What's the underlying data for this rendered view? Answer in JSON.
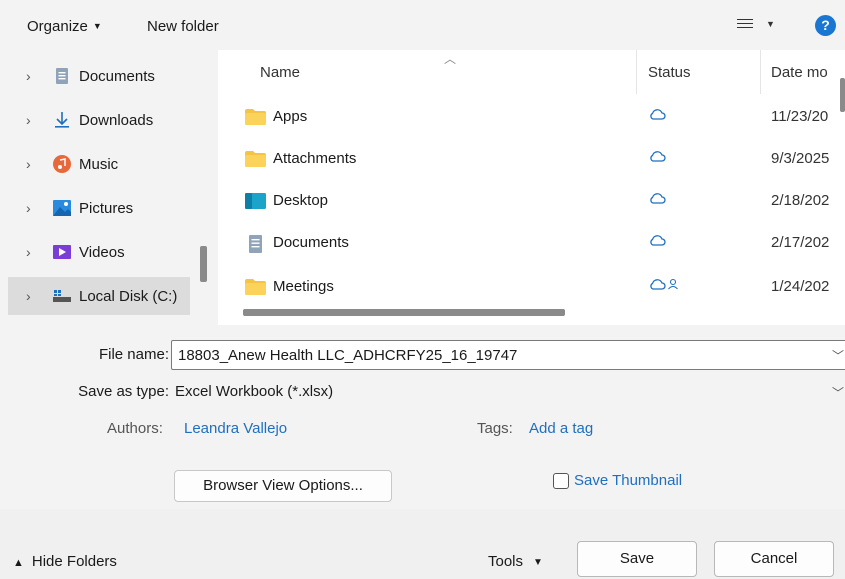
{
  "toolbar": {
    "organize_label": "Organize",
    "new_folder_label": "New folder",
    "help_label": "?"
  },
  "nav": {
    "items": [
      {
        "label": "Documents",
        "icon": "document-icon"
      },
      {
        "label": "Downloads",
        "icon": "download-arrow-icon"
      },
      {
        "label": "Music",
        "icon": "music-icon"
      },
      {
        "label": "Pictures",
        "icon": "pictures-icon"
      },
      {
        "label": "Videos",
        "icon": "videos-icon"
      },
      {
        "label": "Local Disk (C:)",
        "icon": "drive-icon",
        "selected": true
      }
    ]
  },
  "list": {
    "columns": {
      "name": "Name",
      "status": "Status",
      "date": "Date mo"
    },
    "rows": [
      {
        "name": "Apps",
        "type": "folder",
        "status": "cloud",
        "date": "11/23/20"
      },
      {
        "name": "Attachments",
        "type": "folder",
        "status": "cloud",
        "date": "9/3/2025"
      },
      {
        "name": "Desktop",
        "type": "desktop",
        "status": "cloud",
        "date": "2/18/202"
      },
      {
        "name": "Documents",
        "type": "document",
        "status": "cloud",
        "date": "2/17/202"
      },
      {
        "name": "Meetings",
        "type": "folder",
        "status": "cloud-shared",
        "date": "1/24/202"
      }
    ]
  },
  "form": {
    "file_name_label": "File name:",
    "file_name_value": "18803_Anew Health LLC_ADHCRFY25_16_19747",
    "save_type_label": "Save as type:",
    "save_type_value": "Excel Workbook (*.xlsx)",
    "authors_label": "Authors:",
    "authors_value": "Leandra Vallejo",
    "tags_label": "Tags:",
    "tags_value": "Add a tag",
    "browser_view_label": "Browser View Options...",
    "save_thumbnail_label": "Save Thumbnail"
  },
  "bottom": {
    "hide_folders_label": "Hide Folders",
    "tools_label": "Tools",
    "save_label": "Save",
    "cancel_label": "Cancel"
  },
  "colors": {
    "folder": "#f6c443",
    "cloud": "#1f6fbf",
    "link": "#1f6fbf",
    "help": "#1976d2"
  }
}
